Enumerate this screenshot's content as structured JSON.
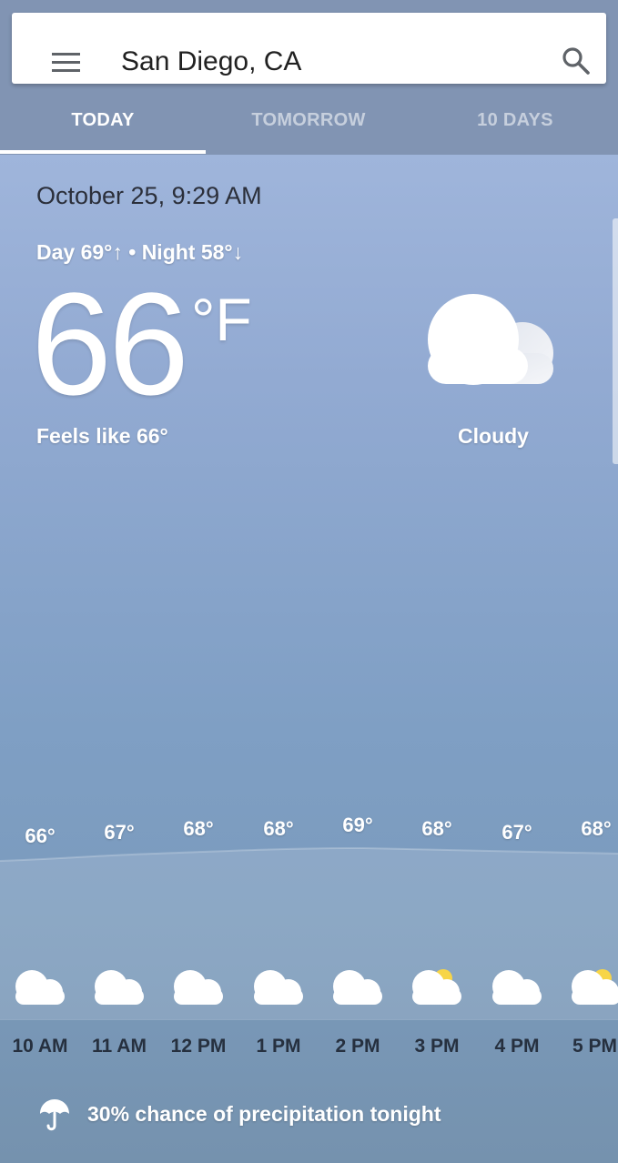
{
  "search": {
    "location": "San Diego, CA"
  },
  "tabs": [
    {
      "label": "TODAY",
      "active": true
    },
    {
      "label": "TOMORROW",
      "active": false
    },
    {
      "label": "10 DAYS",
      "active": false
    }
  ],
  "current": {
    "datetime": "October 25, 9:29 AM",
    "day_night": "Day 69°↑ • Night 58°↓",
    "temperature": "66",
    "unit": "°F",
    "feels_like": "Feels like 66°",
    "condition": "Cloudy",
    "condition_icon": "cloudy-icon"
  },
  "hourly": [
    {
      "time": "10 AM",
      "temp": "66°",
      "icon": "cloudy-icon"
    },
    {
      "time": "11 AM",
      "temp": "67°",
      "icon": "cloudy-icon"
    },
    {
      "time": "12 PM",
      "temp": "68°",
      "icon": "cloudy-icon"
    },
    {
      "time": "1 PM",
      "temp": "68°",
      "icon": "cloudy-icon"
    },
    {
      "time": "2 PM",
      "temp": "69°",
      "icon": "cloudy-icon"
    },
    {
      "time": "3 PM",
      "temp": "68°",
      "icon": "partly-cloudy-icon"
    },
    {
      "time": "4 PM",
      "temp": "67°",
      "icon": "cloudy-icon"
    },
    {
      "time": "5 PM",
      "temp": "68°",
      "icon": "partly-cloudy-icon"
    }
  ],
  "precipitation": {
    "text": "30% chance of precipitation tonight",
    "icon": "umbrella-icon"
  },
  "colors": {
    "topbar": "#8194b3",
    "sky_top": "#9fb5db",
    "sky_bottom": "#7592ae",
    "sun": "#f7d547"
  }
}
